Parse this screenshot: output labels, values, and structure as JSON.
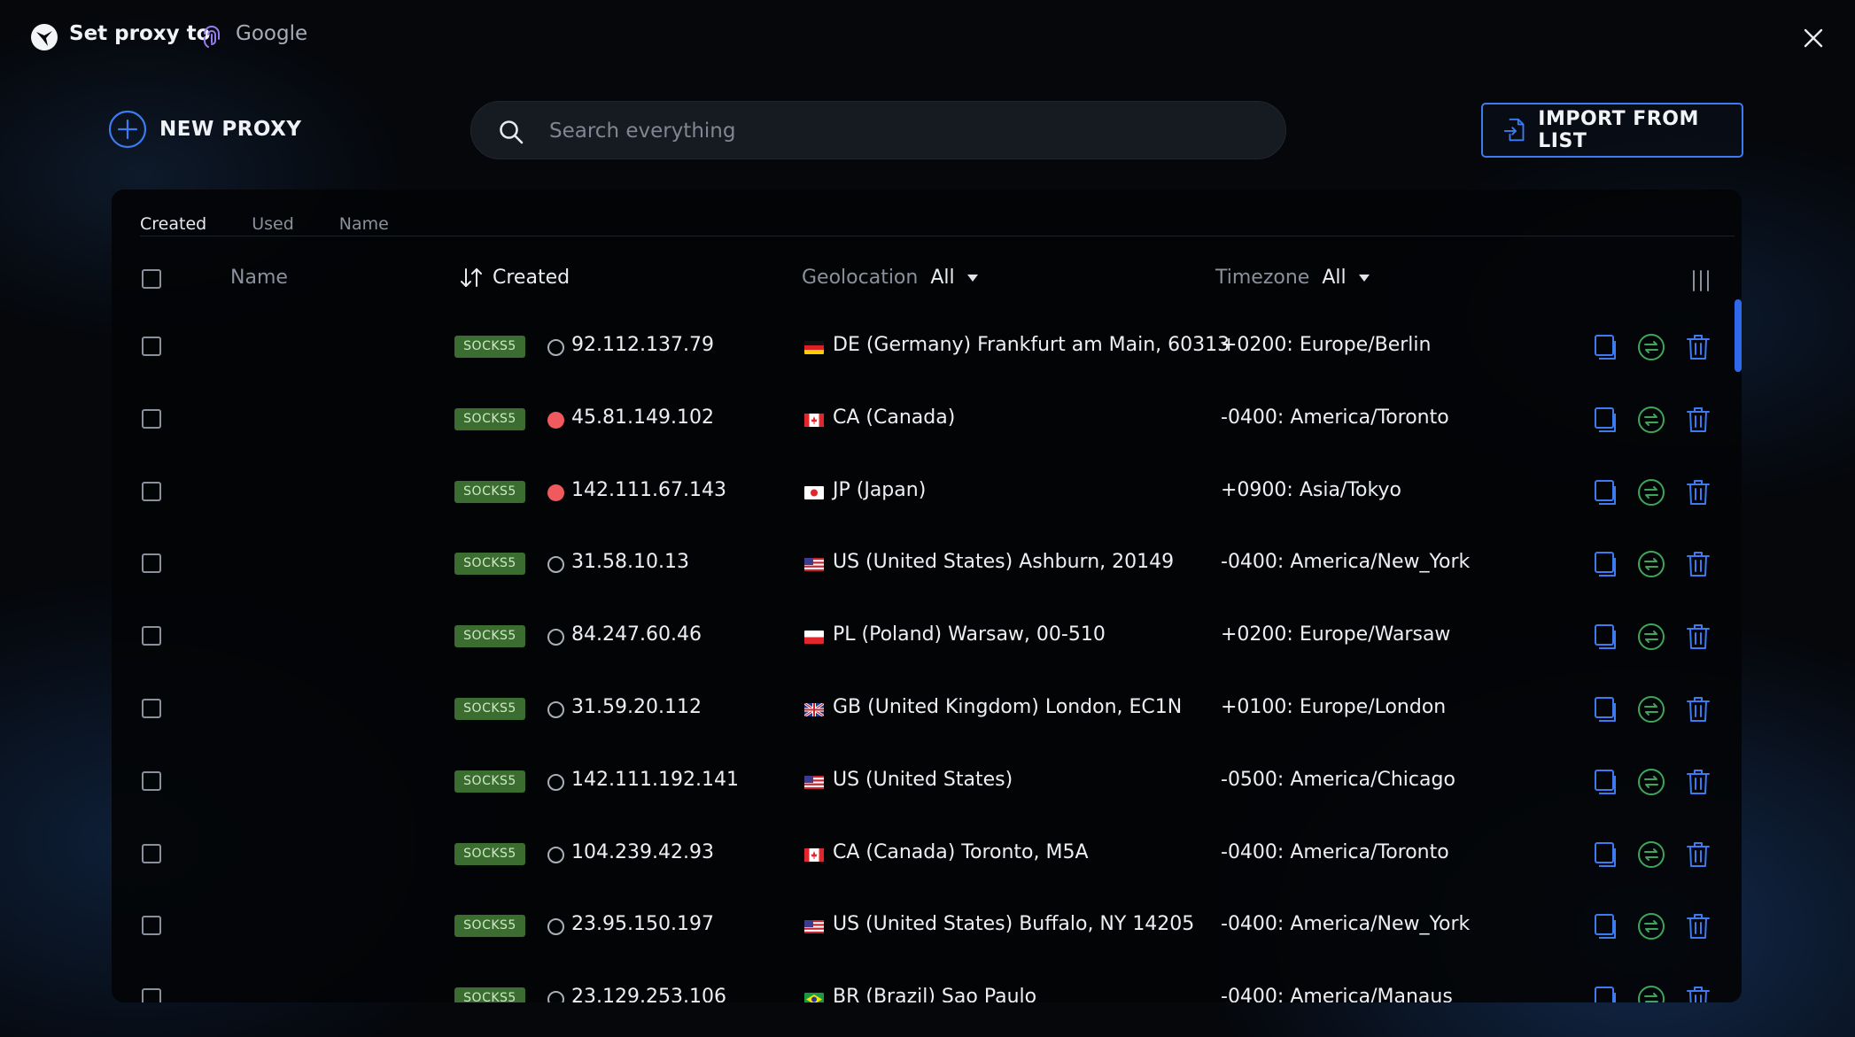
{
  "topbar": {
    "title": "Set proxy to",
    "profile_name": "Google"
  },
  "toolbar": {
    "new_proxy_label": "NEW PROXY",
    "search_placeholder": "Search everything",
    "import_label": "IMPORT FROM LIST"
  },
  "sort_tabs": [
    "Created",
    "Used",
    "Name"
  ],
  "active_sort_tab": "Created",
  "table": {
    "columns": {
      "name": "Name",
      "created": "Created",
      "geolocation": "Geolocation",
      "geolocation_filter": "All",
      "timezone": "Timezone",
      "timezone_filter": "All"
    },
    "rows": [
      {
        "type": "SOCKS5",
        "status": "offline",
        "ip": "92.112.137.79",
        "country": "de",
        "geo": "DE (Germany) Frankfurt am Main, 60313",
        "tz": "+0200: Europe/Berlin"
      },
      {
        "type": "SOCKS5",
        "status": "error",
        "ip": "45.81.149.102",
        "country": "ca",
        "geo": "CA (Canada)",
        "tz": "-0400: America/Toronto"
      },
      {
        "type": "SOCKS5",
        "status": "error",
        "ip": "142.111.67.143",
        "country": "jp",
        "geo": "JP (Japan)",
        "tz": "+0900: Asia/Tokyo"
      },
      {
        "type": "SOCKS5",
        "status": "offline",
        "ip": "31.58.10.13",
        "country": "us",
        "geo": "US (United States) Ashburn, 20149",
        "tz": "-0400: America/New_York"
      },
      {
        "type": "SOCKS5",
        "status": "offline",
        "ip": "84.247.60.46",
        "country": "pl",
        "geo": "PL (Poland) Warsaw, 00-510",
        "tz": "+0200: Europe/Warsaw"
      },
      {
        "type": "SOCKS5",
        "status": "offline",
        "ip": "31.59.20.112",
        "country": "gb",
        "geo": "GB (United Kingdom) London, EC1N",
        "tz": "+0100: Europe/London"
      },
      {
        "type": "SOCKS5",
        "status": "offline",
        "ip": "142.111.192.141",
        "country": "us",
        "geo": "US (United States)",
        "tz": "-0500: America/Chicago"
      },
      {
        "type": "SOCKS5",
        "status": "offline",
        "ip": "104.239.42.93",
        "country": "ca",
        "geo": "CA (Canada) Toronto, M5A",
        "tz": "-0400: America/Toronto"
      },
      {
        "type": "SOCKS5",
        "status": "offline",
        "ip": "23.95.150.197",
        "country": "us",
        "geo": "US (United States) Buffalo, NY 14205",
        "tz": "-0400: America/New_York"
      },
      {
        "type": "SOCKS5",
        "status": "offline",
        "ip": "23.129.253.106",
        "country": "br",
        "geo": "BR (Brazil) Sao Paulo",
        "tz": "-0400: America/Manaus"
      }
    ]
  },
  "colors": {
    "accent": "#3c7bf0",
    "badge_bg": "#3b6d30",
    "error_status": "#f0595d",
    "refresh_icon": "#3ea55a",
    "action_icon": "#3c7bf0"
  },
  "icons": {
    "logo": "app-logo-icon",
    "profile": "fingerprint-icon",
    "close": "close-icon",
    "new_proxy": "plus-circle-icon",
    "search": "search-icon",
    "import": "file-import-icon",
    "sort": "sort-arrows-icon",
    "columns": "columns-icon",
    "copy": "copy-icon",
    "refresh": "refresh-icon",
    "delete": "trash-icon"
  }
}
